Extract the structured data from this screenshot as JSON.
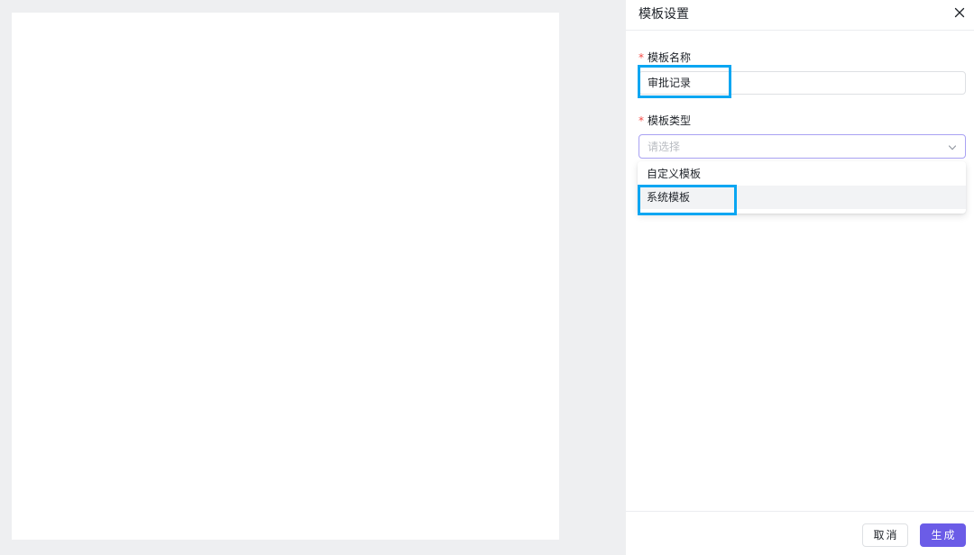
{
  "drawer": {
    "title": "模板设置",
    "close_icon": "close-icon"
  },
  "form": {
    "name_field": {
      "required_mark": "*",
      "label": "模板名称",
      "value": "审批记录"
    },
    "type_field": {
      "required_mark": "*",
      "label": "模板类型",
      "placeholder": "请选择",
      "chevron_icon": "chevron-down-icon",
      "options": [
        {
          "label": "自定义模板"
        },
        {
          "label": "系统模板"
        }
      ]
    }
  },
  "footer": {
    "cancel_label": "取消",
    "generate_label": "生成"
  },
  "colors": {
    "primary": "#6b5ce7",
    "highlight": "#0aa6f2",
    "required": "#f54a45"
  }
}
